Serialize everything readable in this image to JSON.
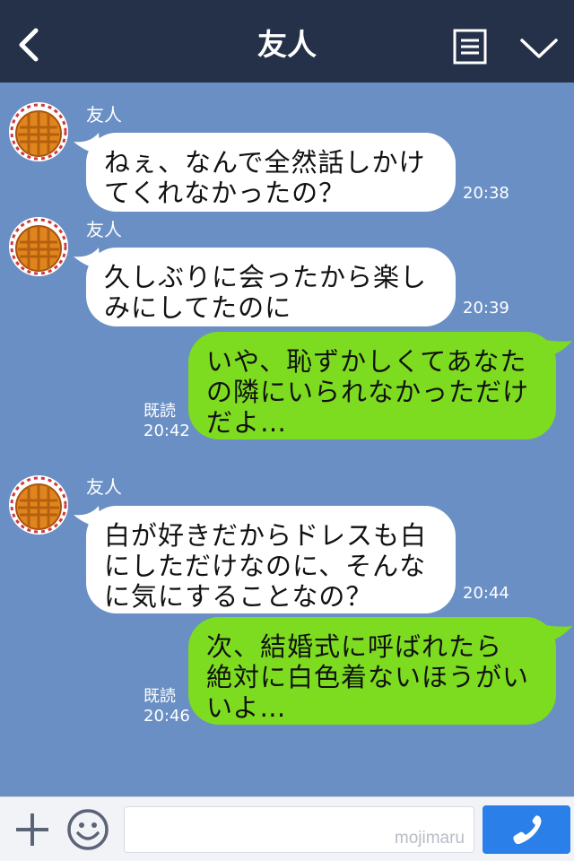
{
  "header": {
    "title": "友人",
    "back_icon": "chevron-left-icon",
    "notes_icon": "notes-icon",
    "menu_icon": "chevron-down-icon",
    "background": "#243148"
  },
  "chat": {
    "background": "#6a8fc4",
    "messages": [
      {
        "direction": "incoming",
        "sender": "友人",
        "lines": [
          "ねぇ、なんで全然話しかけ",
          "てくれなかったの？"
        ],
        "time": "20:38"
      },
      {
        "direction": "incoming",
        "sender": "友人",
        "lines": [
          "久しぶりに会ったから楽し",
          "みにしてたのに"
        ],
        "time": "20:39"
      },
      {
        "direction": "outgoing",
        "read": "既読",
        "lines": [
          "いや、恥ずかしくてあなた",
          "の隣にいられなかっただけ",
          "だよ…"
        ],
        "time": "20:42"
      },
      {
        "direction": "incoming",
        "sender": "友人",
        "lines": [
          "白が好きだからドレスも白",
          "にしただけなのに、そんな",
          "に気にすることなの？"
        ],
        "time": "20:44"
      },
      {
        "direction": "outgoing",
        "read": "既読",
        "lines": [
          "次、結婚式に呼ばれたら",
          "絶対に白色着ないほうがい",
          "いよ…"
        ],
        "time": "20:46"
      }
    ],
    "incoming_bubble_color": "#ffffff",
    "outgoing_bubble_color": "#7ddc1f"
  },
  "input_bar": {
    "plus_icon": "plus-icon",
    "emoji_icon": "smiley-icon",
    "watermark": "mojimaru",
    "call_icon": "phone-icon",
    "call_button_color": "#2b7fe8"
  }
}
